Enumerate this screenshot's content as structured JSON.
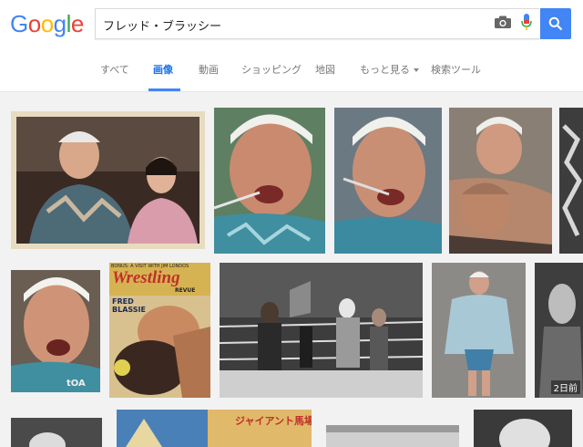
{
  "logo": {
    "letters": [
      "G",
      "o",
      "o",
      "g",
      "l",
      "e"
    ],
    "colors": [
      "#4285f4",
      "#ea4335",
      "#fbbc05",
      "#4285f4",
      "#34a853",
      "#ea4335"
    ]
  },
  "search": {
    "query": "フレッド・ブラッシー"
  },
  "tabs": [
    {
      "label": "すべて"
    },
    {
      "label": "画像"
    },
    {
      "label": "動画"
    },
    {
      "label": "ショッピング"
    },
    {
      "label": "地図"
    },
    {
      "label": "もっと見る"
    },
    {
      "label": "検索ツール"
    }
  ],
  "active_tab": "画像",
  "results": {
    "magazine": {
      "brand": "Wrestling",
      "subtitle": "REVUE",
      "note": "BONUS: A VISIT WITH JIM LONDOS",
      "name1": "FRED",
      "name2": "BLASSIE"
    },
    "row3_banner": "ジャイアント馬場",
    "age_label": "2日前",
    "watermark": "tOA"
  },
  "colors": {
    "accent": "#4285f4",
    "active_tab": "#1a73e8"
  }
}
